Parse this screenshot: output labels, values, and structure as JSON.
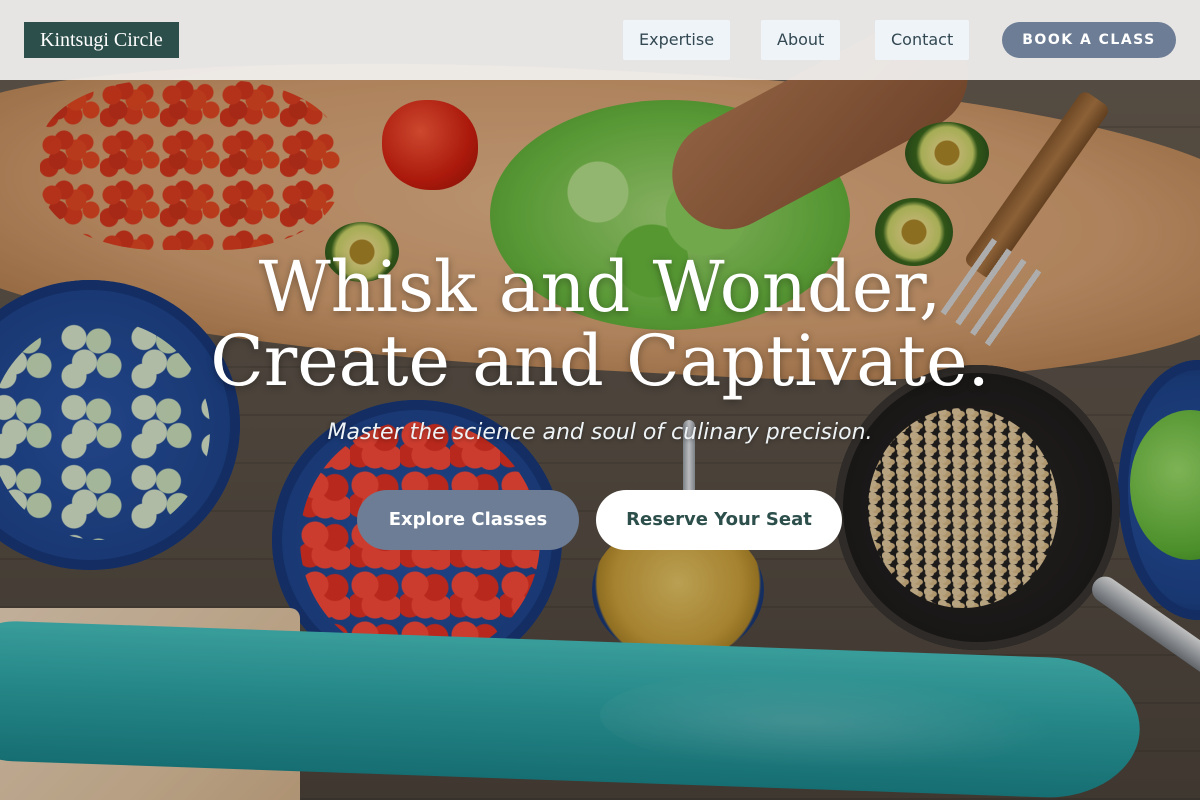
{
  "header": {
    "logo_text": "Kintsugi Circle",
    "nav": [
      {
        "label": "Expertise"
      },
      {
        "label": "About"
      },
      {
        "label": "Contact"
      }
    ],
    "book_button_label": "BOOK A CLASS"
  },
  "hero": {
    "title_line_1": "Whisk and Wonder,",
    "title_line_2": "Create and Captivate.",
    "subtitle": "Master the science and soul of culinary precision.",
    "primary_cta_label": "Explore Classes",
    "secondary_cta_label": "Reserve Your Seat",
    "background_image": "cooking-ingredients-table-photo"
  },
  "colors": {
    "logo_bg": "#2c4f4b",
    "accent_button": "#6c7d95",
    "nav_button_bg": "#eef4f8",
    "secondary_cta_text": "#2c4f4b"
  }
}
